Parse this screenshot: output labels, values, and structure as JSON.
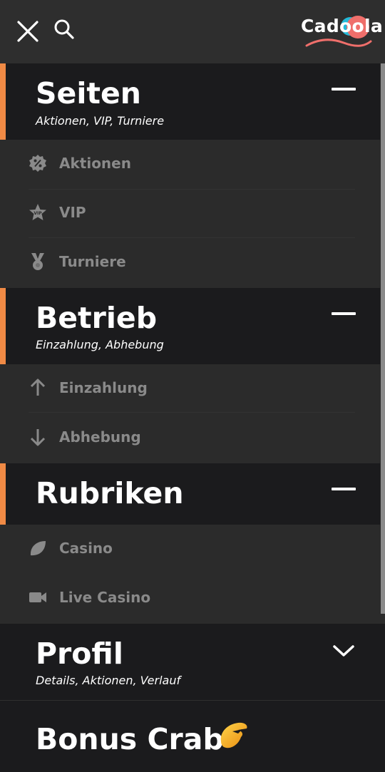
{
  "header": {
    "logo_text": "Cadoola",
    "icons": {
      "close": "close-icon",
      "search": "search-icon"
    },
    "colors": {
      "background": "#2e2e2e",
      "logo_blue": "#23b9d8",
      "logo_coral": "#ef6f6b"
    }
  },
  "sections": {
    "seiten": {
      "title": "Seiten",
      "subtitle": "Aktionen, VIP, Turniere",
      "expanded": true,
      "items": [
        {
          "label": "Aktionen",
          "icon": "percent-badge-icon"
        },
        {
          "label": "VIP",
          "icon": "vip-star-icon"
        },
        {
          "label": "Turniere",
          "icon": "medal-icon"
        }
      ]
    },
    "betrieb": {
      "title": "Betrieb",
      "subtitle": "Einzahlung, Abhebung",
      "expanded": true,
      "items": [
        {
          "label": "Einzahlung",
          "icon": "arrow-up-icon"
        },
        {
          "label": "Abhebung",
          "icon": "arrow-down-icon"
        }
      ]
    },
    "rubriken": {
      "title": "Rubriken",
      "expanded": true,
      "items": [
        {
          "label": "Casino",
          "icon": "leaf-icon"
        },
        {
          "label": "Live Casino",
          "icon": "video-camera-icon"
        }
      ]
    },
    "profil": {
      "title": "Profil",
      "subtitle": "Details, Aktionen, Verlauf",
      "expanded": false
    },
    "bonus": {
      "title": "Bonus Crab",
      "icon": "crab-claw-icon"
    }
  },
  "colors": {
    "accent": "#f08a45",
    "section_bg": "#1b1b1d",
    "item_bg": "#2b2b2b",
    "item_text": "#8a8a8a",
    "crab_gold": "#f5a623"
  }
}
